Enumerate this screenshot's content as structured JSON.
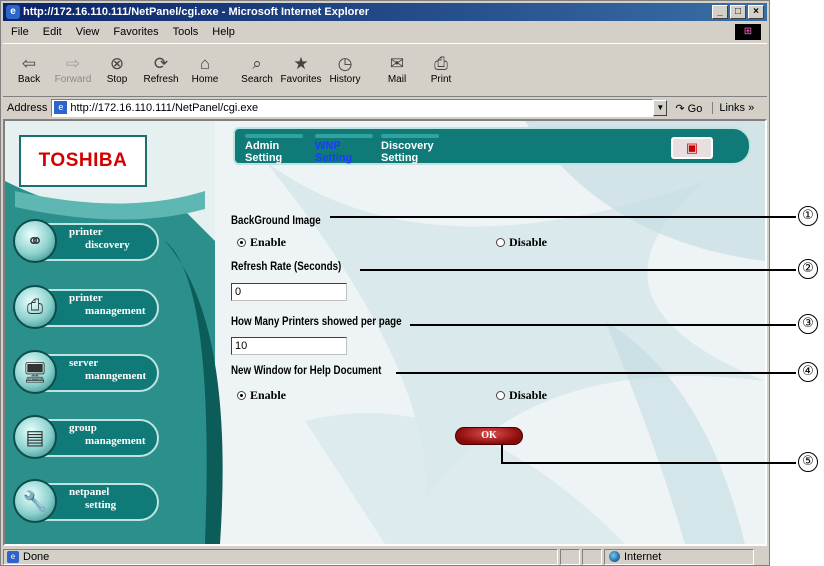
{
  "window": {
    "title": "http://172.16.110.111/NetPanel/cgi.exe - Microsoft Internet Explorer",
    "controls": [
      "_",
      "□",
      "×"
    ]
  },
  "menu": [
    "File",
    "Edit",
    "View",
    "Favorites",
    "Tools",
    "Help"
  ],
  "toolbar": {
    "back": "Back",
    "forward": "Forward",
    "stop": "Stop",
    "refresh": "Refresh",
    "home": "Home",
    "search": "Search",
    "favorites": "Favorites",
    "history": "History",
    "mail": "Mail",
    "print": "Print"
  },
  "address": {
    "label": "Address",
    "url": "http://172.16.110.111/NetPanel/cgi.exe",
    "go": "Go",
    "links": "Links"
  },
  "page": {
    "logo": "TOSHIBA",
    "nav": [
      {
        "line1": "printer",
        "line2": "discovery",
        "icon": "binoculars-icon"
      },
      {
        "line1": "printer",
        "line2": "management",
        "icon": "printer-icon"
      },
      {
        "line1": "server",
        "line2": "manngement",
        "icon": "server-icon"
      },
      {
        "line1": "group",
        "line2": "management",
        "icon": "printer-group-icon"
      },
      {
        "line1": "netpanel",
        "line2": "setting",
        "icon": "wrench-icon"
      }
    ],
    "tabs": {
      "admin_1": "Admin",
      "admin_2": "Setting",
      "wnp_1": "WNP",
      "wnp_2": "Setting",
      "discovery_1": "Discovery",
      "discovery_2": "Setting"
    },
    "form": {
      "bg_label": "BackGround Image",
      "bg_enable": "Enable",
      "bg_disable": "Disable",
      "bg_value": "Enable",
      "refresh_label": "Refresh Rate (Seconds)",
      "refresh_value": "0",
      "printers_label": "How Many Printers showed per page",
      "printers_value": "10",
      "help_label": "New Window for Help Document",
      "help_enable": "Enable",
      "help_disable": "Disable",
      "help_value": "Enable",
      "ok": "OK"
    }
  },
  "callouts": [
    "①",
    "②",
    "③",
    "④",
    "⑤"
  ],
  "status": {
    "text": "Done",
    "zone": "Internet"
  },
  "colors": {
    "panel_teal": "#0f7a78",
    "logo_red": "#d40000",
    "active_tab": "#1a3cff",
    "ok_button": "#a01010"
  }
}
